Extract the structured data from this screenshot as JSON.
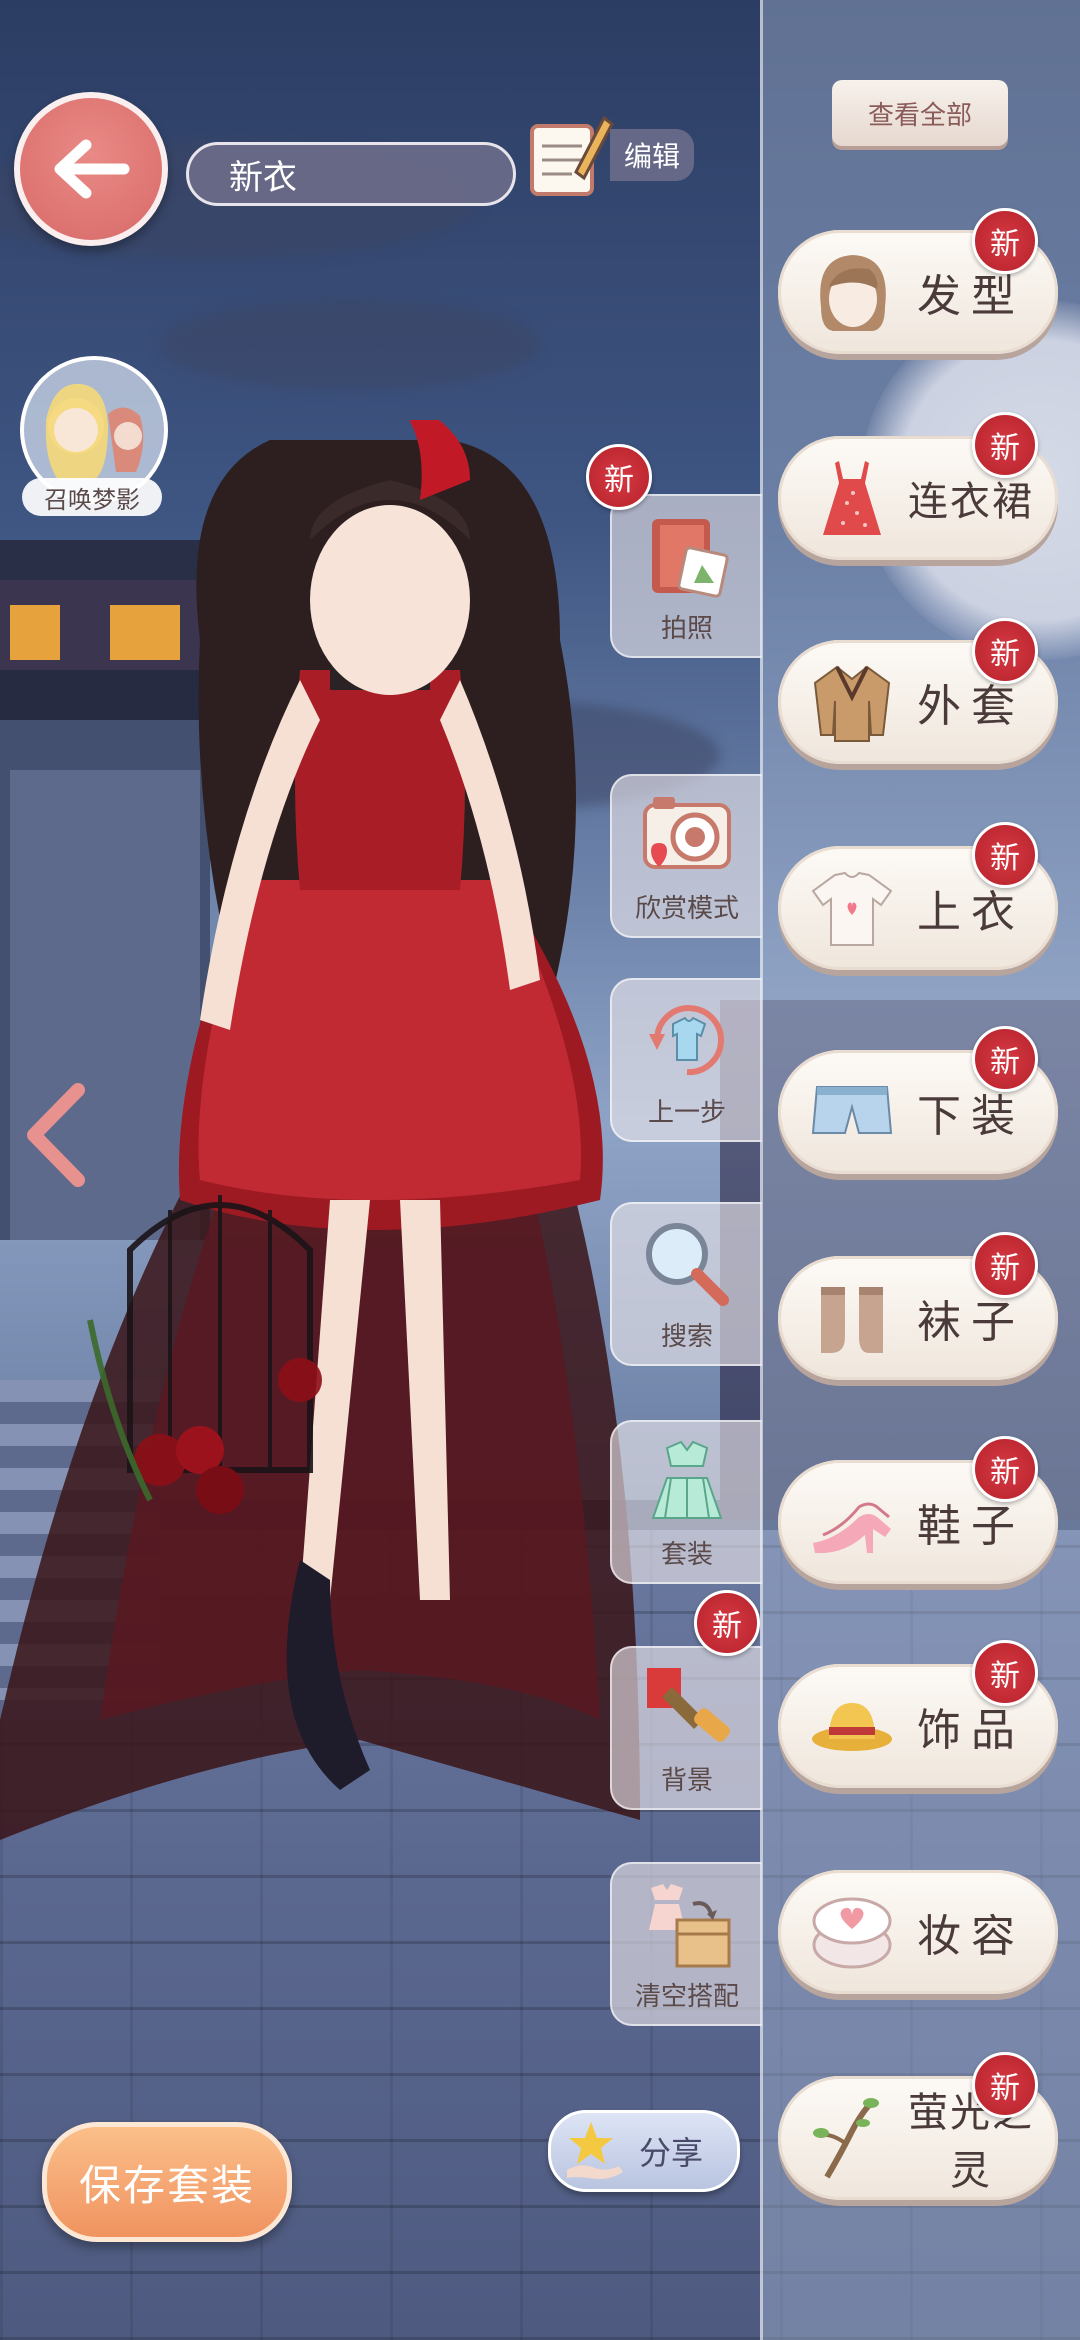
{
  "header": {
    "outfit_name": "新衣",
    "edit_label": "编辑",
    "summon_label": "召唤梦影"
  },
  "tools": [
    {
      "id": "photo",
      "label": "拍照",
      "new": true
    },
    {
      "id": "appreciate",
      "label": "欣赏模式",
      "new": false
    },
    {
      "id": "undo",
      "label": "上一步",
      "new": false
    },
    {
      "id": "search",
      "label": "搜索",
      "new": false
    },
    {
      "id": "set",
      "label": "套装",
      "new": false
    },
    {
      "id": "background",
      "label": "背景",
      "new": true
    },
    {
      "id": "clear",
      "label": "清空搭配",
      "new": false
    }
  ],
  "categories": {
    "view_all": "查看全部",
    "new_badge": "新",
    "items": [
      {
        "id": "hair",
        "label": "发型",
        "new": true
      },
      {
        "id": "dress",
        "label": "连衣裙",
        "new": true
      },
      {
        "id": "coat",
        "label": "外套",
        "new": true
      },
      {
        "id": "top",
        "label": "上衣",
        "new": true
      },
      {
        "id": "bottom",
        "label": "下装",
        "new": true
      },
      {
        "id": "socks",
        "label": "袜子",
        "new": true
      },
      {
        "id": "shoes",
        "label": "鞋子",
        "new": true
      },
      {
        "id": "accessories",
        "label": "饰品",
        "new": true
      },
      {
        "id": "makeup",
        "label": "妆容",
        "new": false
      },
      {
        "id": "firefly",
        "label": "萤光之灵",
        "new": true
      }
    ]
  },
  "footer": {
    "save_label": "保存套装",
    "share_label": "分享"
  },
  "colors": {
    "accent_red": "#c62a33",
    "save_orange": "#f09360",
    "back_pink": "#d86a68"
  }
}
